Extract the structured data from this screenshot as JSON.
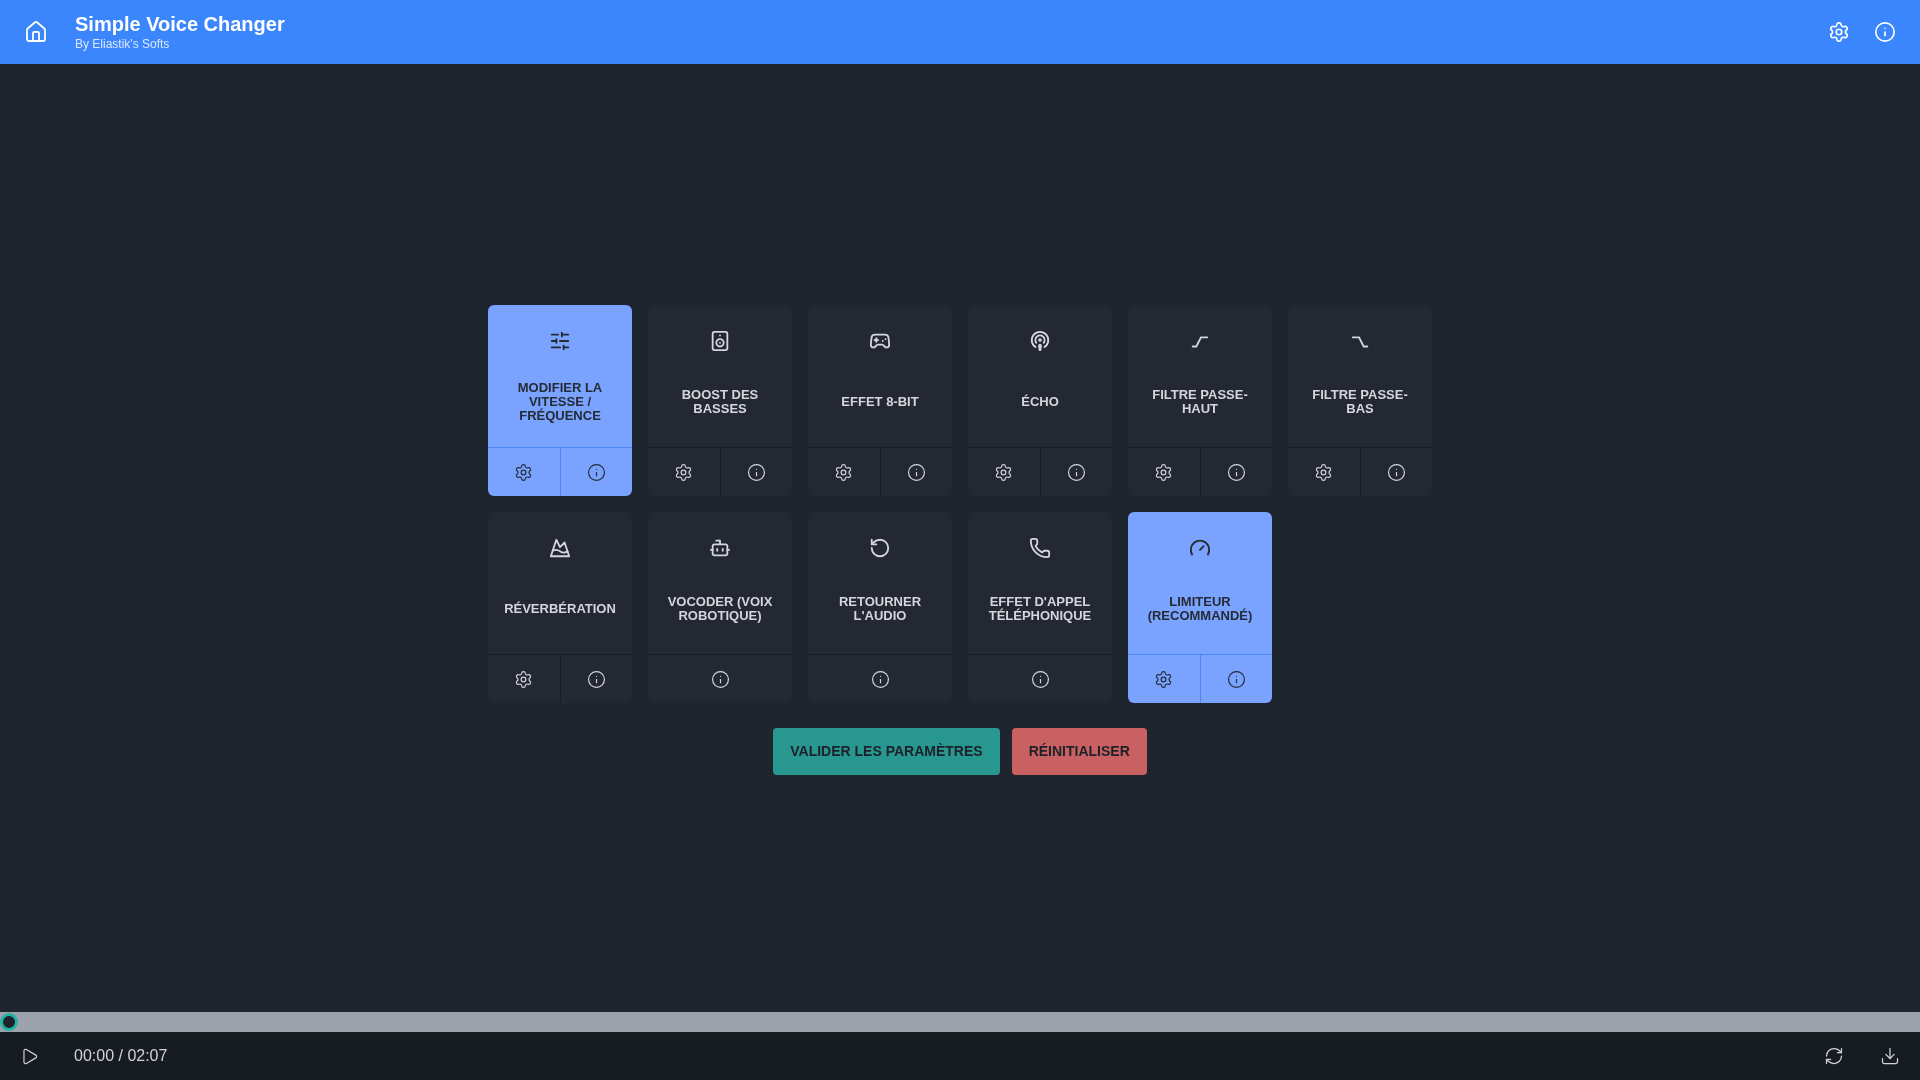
{
  "header": {
    "title": "Simple Voice Changer",
    "subtitle": "By Eliastik's Softs"
  },
  "effects": [
    {
      "label": "MODIFIER LA VITESSE / FRÉQUENCE",
      "selected": true,
      "has_settings": true
    },
    {
      "label": "BOOST DES BASSES",
      "selected": false,
      "has_settings": true
    },
    {
      "label": "EFFET 8-BIT",
      "selected": false,
      "has_settings": true
    },
    {
      "label": "ÉCHO",
      "selected": false,
      "has_settings": true
    },
    {
      "label": "FILTRE PASSE-HAUT",
      "selected": false,
      "has_settings": true
    },
    {
      "label": "FILTRE PASSE-BAS",
      "selected": false,
      "has_settings": true
    },
    {
      "label": "RÉVERBÉRATION",
      "selected": false,
      "has_settings": true
    },
    {
      "label": "VOCODER (VOIX ROBOTIQUE)",
      "selected": false,
      "has_settings": false
    },
    {
      "label": "RETOURNER L'AUDIO",
      "selected": false,
      "has_settings": false
    },
    {
      "label": "EFFET D'APPEL TÉLÉPHONIQUE",
      "selected": false,
      "has_settings": false
    },
    {
      "label": "LIMITEUR (RECOMMANDÉ)",
      "selected": true,
      "has_settings": true
    }
  ],
  "actions": [
    {
      "label": "VALIDER LES PARAMÈTRES",
      "kind": "validate"
    },
    {
      "label": "RÉINITIALISER",
      "kind": "reset"
    }
  ],
  "player": {
    "level": 0,
    "time": "00:00 / 02:07"
  }
}
